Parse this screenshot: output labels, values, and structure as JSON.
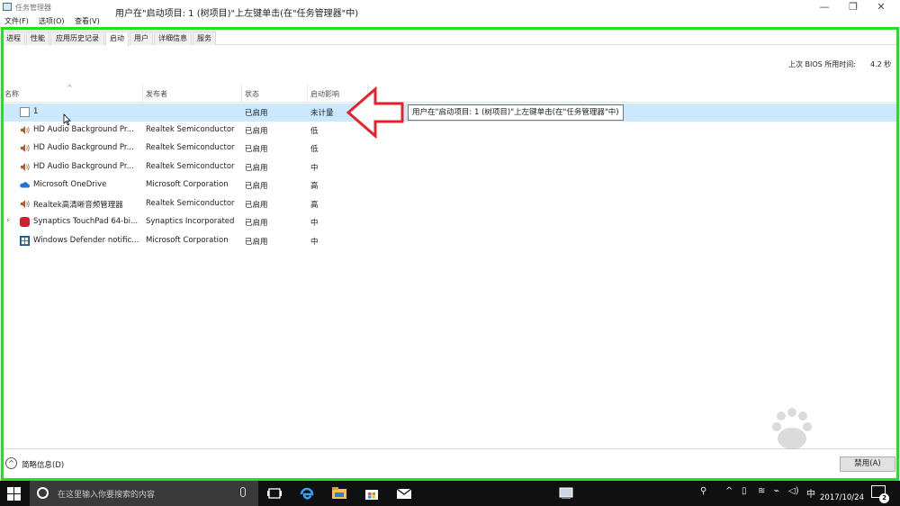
{
  "window": {
    "app_title": "任务管理器",
    "caption": "用户在\"启动项目: 1 (树项目)\"上左键单击(在\"任务管理器\"中)",
    "controls": {
      "minimize": "—",
      "restore": "❐",
      "close": "✕"
    }
  },
  "menu": [
    {
      "label": "文件(F)"
    },
    {
      "label": "选项(O)"
    },
    {
      "label": "查看(V)"
    }
  ],
  "tabs": [
    {
      "label": "进程"
    },
    {
      "label": "性能"
    },
    {
      "label": "应用历史记录"
    },
    {
      "label": "启动",
      "active": true
    },
    {
      "label": "用户"
    },
    {
      "label": "详细信息"
    },
    {
      "label": "服务"
    }
  ],
  "bios": {
    "label": "上次 BIOS 所用时间:",
    "value": "4.2 秒"
  },
  "columns": [
    "名称",
    "发布者",
    "状态",
    "启动影响"
  ],
  "rows": [
    {
      "name": "1",
      "publisher": "",
      "status": "已启用",
      "impact": "未计量",
      "icon": "document-icon",
      "selected": true
    },
    {
      "name": "HD Audio Background Pr...",
      "publisher": "Realtek Semiconductor",
      "status": "已启用",
      "impact": "低",
      "icon": "speaker-icon"
    },
    {
      "name": "HD Audio Background Pr...",
      "publisher": "Realtek Semiconductor",
      "status": "已启用",
      "impact": "低",
      "icon": "speaker-icon"
    },
    {
      "name": "HD Audio Background Pr...",
      "publisher": "Realtek Semiconductor",
      "status": "已启用",
      "impact": "中",
      "icon": "speaker-icon"
    },
    {
      "name": "Microsoft OneDrive",
      "publisher": "Microsoft Corporation",
      "status": "已启用",
      "impact": "高",
      "icon": "onedrive-icon"
    },
    {
      "name": "Realtek高清晰音频管理器",
      "publisher": "Realtek Semiconductor",
      "status": "已启用",
      "impact": "高",
      "icon": "speaker-icon"
    },
    {
      "name": "Synaptics TouchPad 64-bi...",
      "publisher": "Synaptics Incorporated",
      "status": "已启用",
      "impact": "中",
      "icon": "synaptics-icon",
      "expandable": true
    },
    {
      "name": "Windows Defender notific...",
      "publisher": "Microsoft Corporation",
      "status": "已启用",
      "impact": "中",
      "icon": "defender-icon"
    }
  ],
  "tooltip": "用户在\"启动项目: 1 (树项目)\"上左键单击(在\"任务管理器\"中)",
  "footer": {
    "details_label": "简略信息(D)",
    "disable_label": "禁用(A)"
  },
  "taskbar": {
    "search_placeholder": "在这里输入你要搜索的内容",
    "tray_lang": "中",
    "date": "2017/10/24",
    "notification_count": "2"
  },
  "colors": {
    "highlight_frame": "#22e022",
    "selection": "#cce8ff",
    "annotation_arrow": "#e8202a",
    "taskbar": "#101010"
  }
}
